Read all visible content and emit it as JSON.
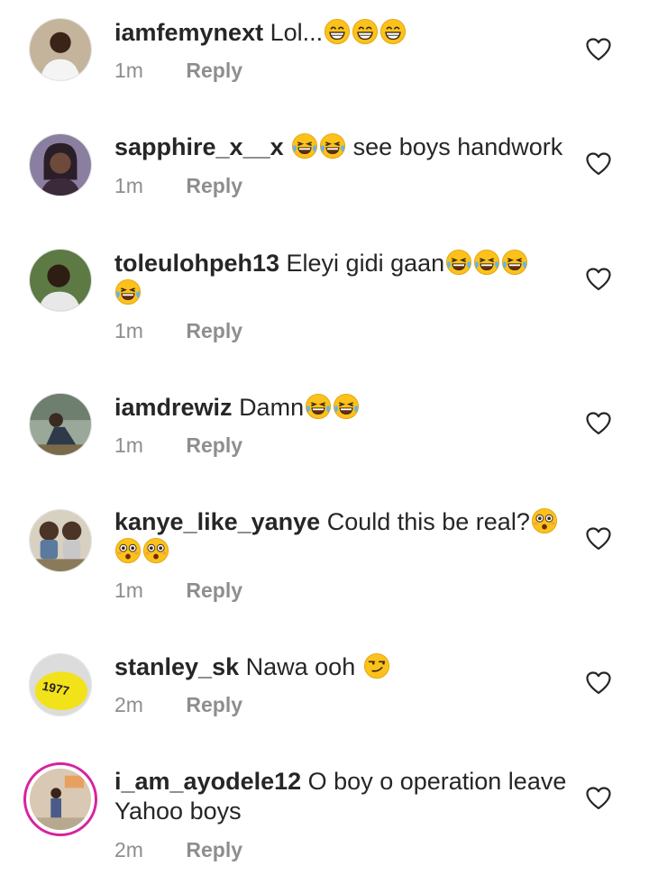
{
  "comments": [
    {
      "username": "iamfemynext",
      "text": "Lol...",
      "emojis": [
        "grin",
        "grin",
        "grin"
      ],
      "time": "1m",
      "reply": "Reply",
      "avatar_color": "#b7a38a"
    },
    {
      "username": "sapphire_x__x",
      "text": "",
      "emojis_before": [
        "joy",
        "joy"
      ],
      "text_after": "see boys handwork",
      "time": "1m",
      "reply": "Reply",
      "avatar_color": "#6a5d80"
    },
    {
      "username": "toleulohpeh13",
      "text": "Eleyi gidi gaan",
      "emojis": [
        "joy",
        "joy",
        "joy",
        "joy"
      ],
      "time": "1m",
      "reply": "Reply",
      "avatar_color": "#4c6a3a"
    },
    {
      "username": "iamdrewiz",
      "text": "Damn",
      "emojis": [
        "joy",
        "joy"
      ],
      "time": "1m",
      "reply": "Reply",
      "avatar_color": "#7a8a7a"
    },
    {
      "username": "kanye_like_yanye",
      "text": "Could this be real?",
      "emojis": [
        "flushed",
        "flushed",
        "flushed"
      ],
      "time": "1m",
      "reply": "Reply",
      "avatar_color": "#5a4a3a"
    },
    {
      "username": "stanley_sk",
      "text": "Nawa ooh",
      "emojis": [
        "smirk"
      ],
      "time": "2m",
      "reply": "Reply",
      "avatar_color": "#f2e21a",
      "avatar_text": "1977"
    },
    {
      "username": "i_am_ayodele12",
      "text": "O boy o operation leave Yahoo boys",
      "emojis": [],
      "time": "2m",
      "reply": "Reply",
      "avatar_color": "#c9b8a8"
    }
  ],
  "icons": {
    "like": "heart-outline-icon",
    "emoji_grin": "grinning-face-icon",
    "emoji_joy": "tears-of-joy-icon",
    "emoji_flushed": "flushed-face-icon",
    "emoji_smirk": "smirking-face-icon"
  },
  "colors": {
    "secondary_text": "#8e8e8e",
    "story_ring": "#d6249f",
    "emoji_yellow": "#fcc21b"
  }
}
